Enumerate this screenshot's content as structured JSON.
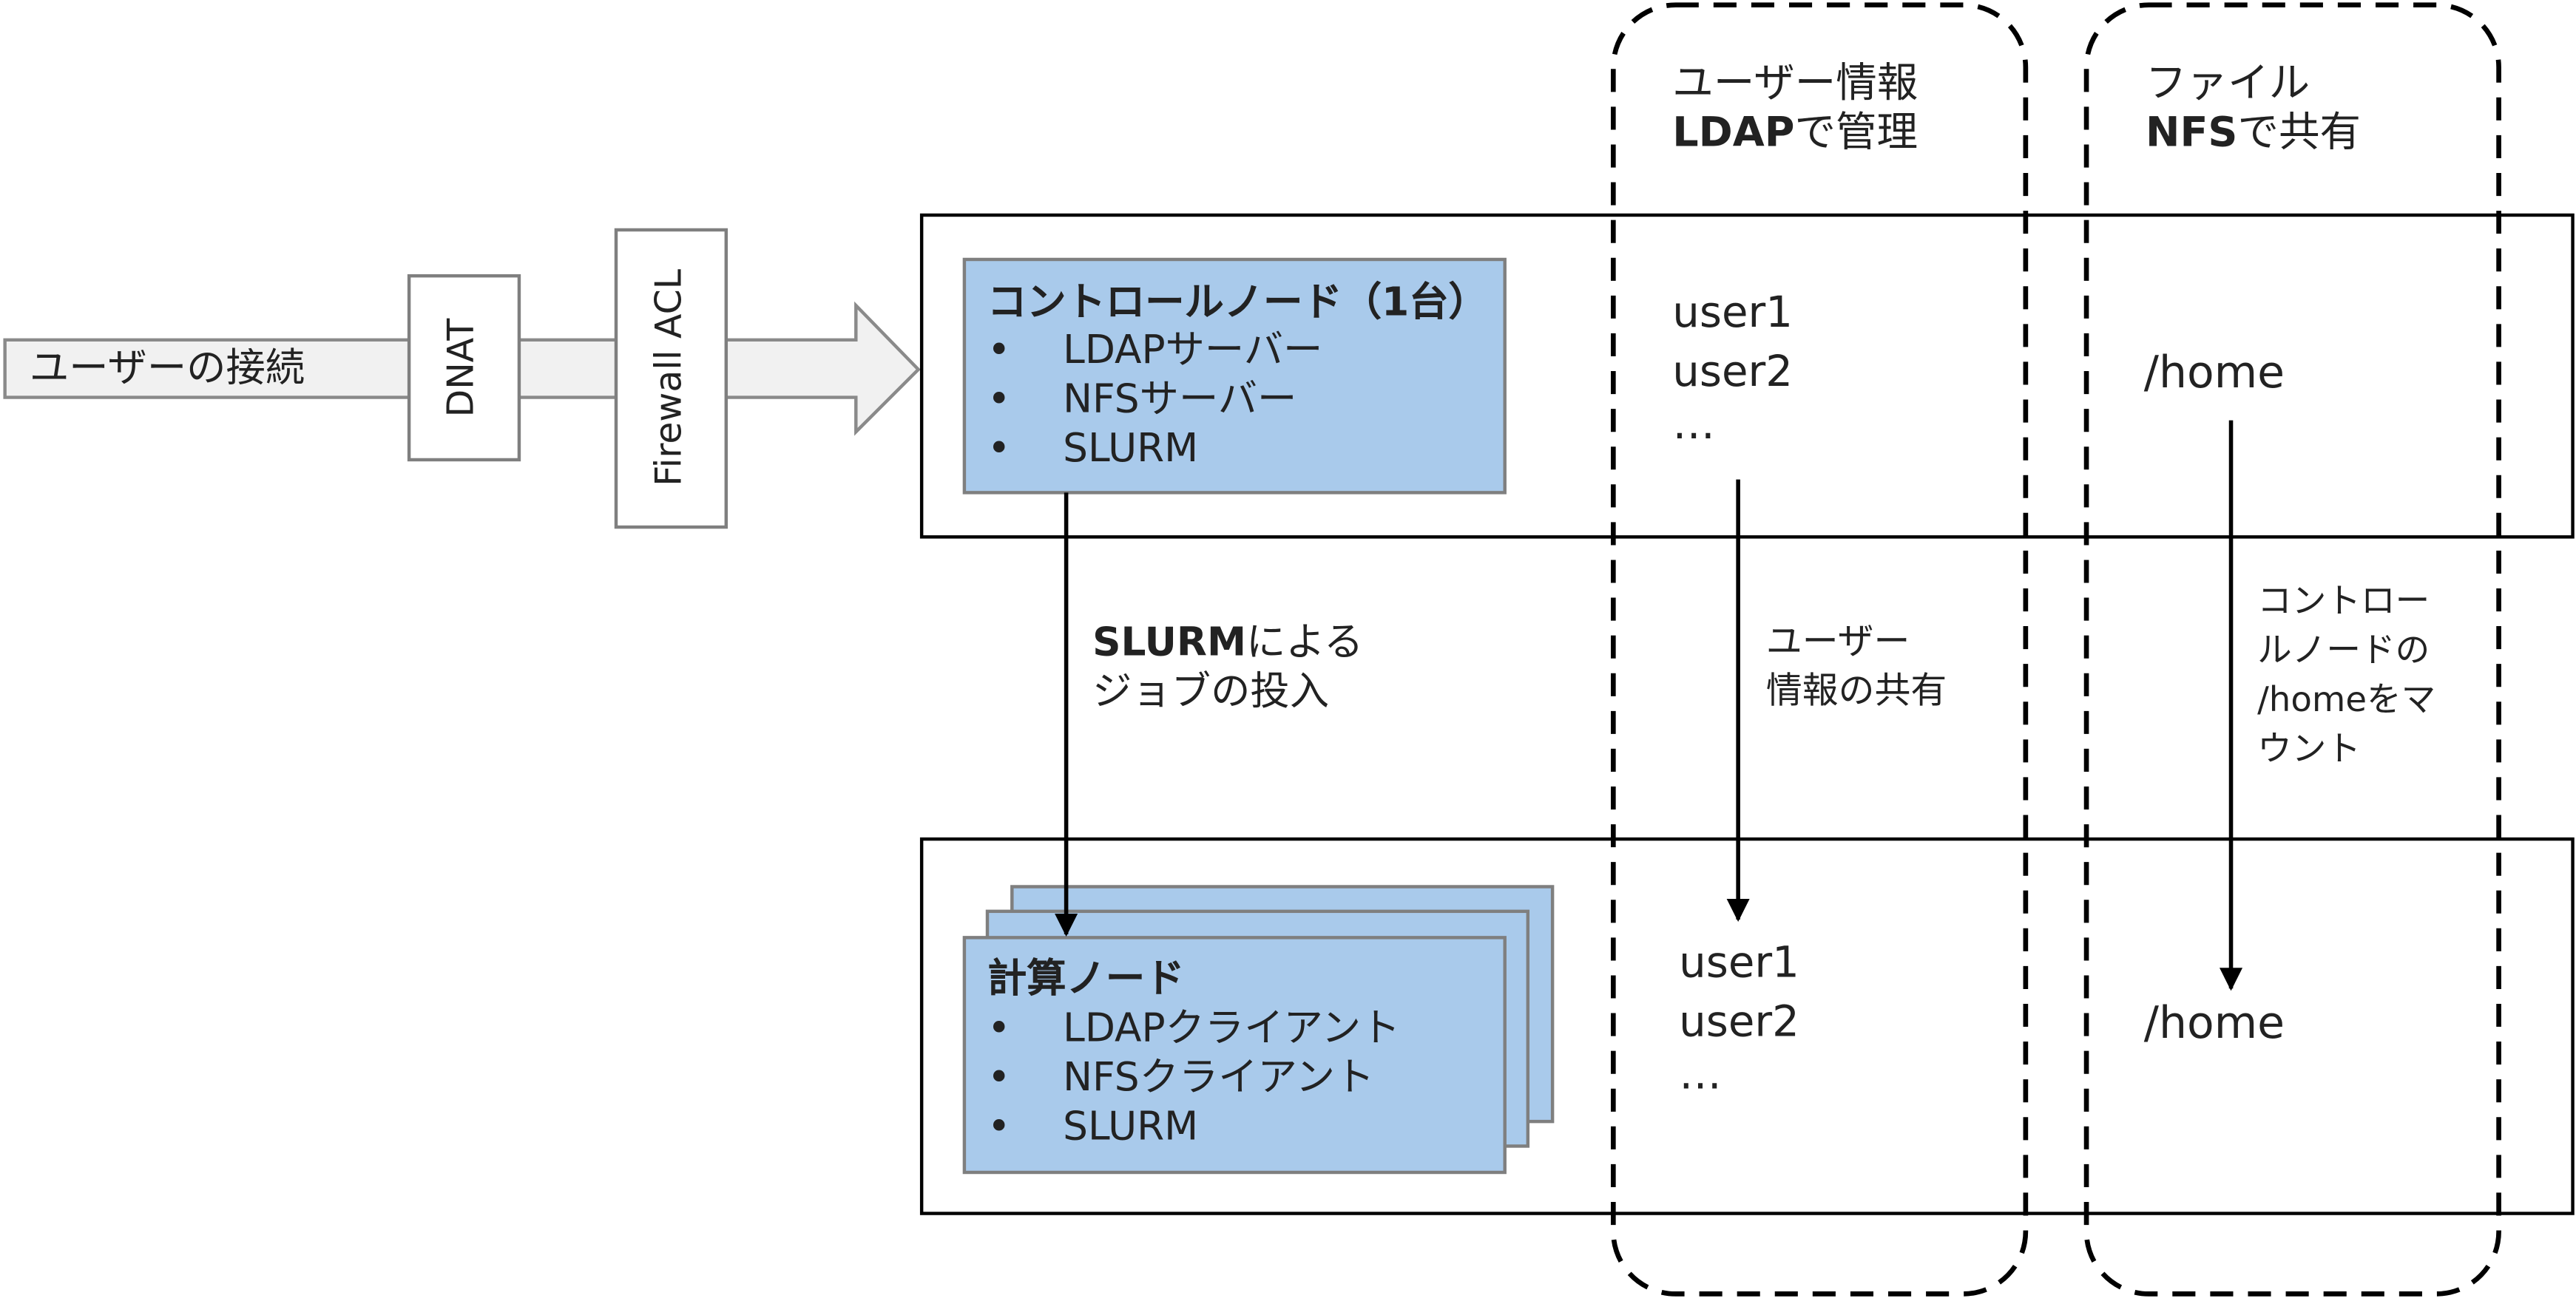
{
  "user_connection": {
    "label": "ユーザーの接続",
    "dnat": "DNAT",
    "firewall": "Firewall ACL"
  },
  "columns": {
    "user_info": {
      "line1": "ユーザー情報",
      "line2_bold": "LDAP",
      "line2_rest": "で管理"
    },
    "files": {
      "line1": "ファイル",
      "line2_bold": "NFS",
      "line2_rest": "で共有"
    }
  },
  "control_node": {
    "title": "コントロールノード（1台）",
    "items": [
      "LDAPサーバー",
      "NFSサーバー",
      "SLURM"
    ],
    "users": [
      "user1",
      "user2",
      "…"
    ],
    "home": "/home"
  },
  "compute_node": {
    "title": "計算ノード",
    "items": [
      "LDAPクライアント",
      "NFSクライアント",
      "SLURM"
    ],
    "users": [
      "user1",
      "user2",
      "…"
    ],
    "home": "/home"
  },
  "arrows": {
    "slurm_bold": "SLURM",
    "slurm_rest": "による",
    "slurm_line2": "ジョブの投入",
    "user_share_line1": "ユーザー",
    "user_share_line2": "情報の共有",
    "mount_lines": [
      "コントロー",
      "ルノードの",
      "/homeをマ",
      "ウント"
    ]
  },
  "bullet_char": "•"
}
